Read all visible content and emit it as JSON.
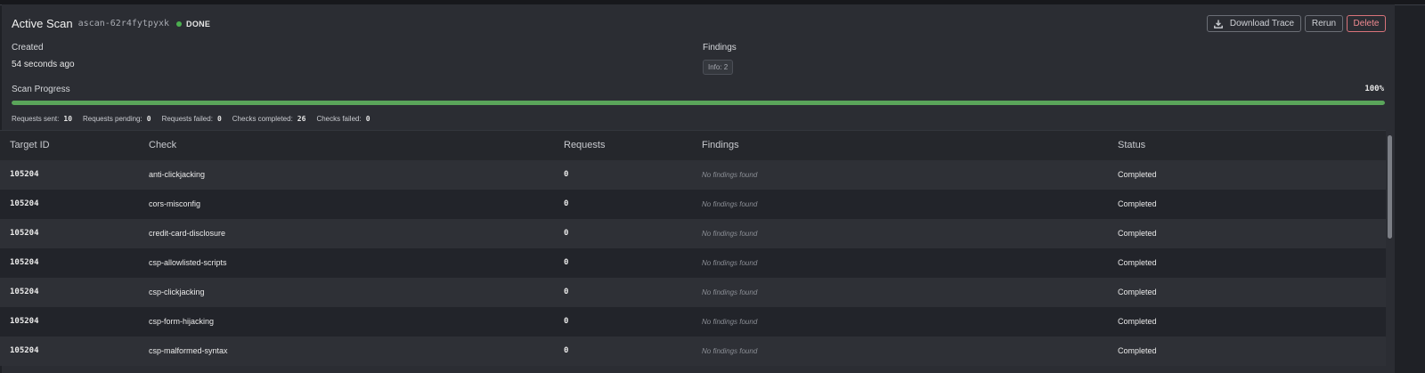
{
  "header": {
    "title": "Active Scan",
    "scan_id": "ascan-62r4fytpyxk",
    "status": "DONE",
    "status_color": "#4caf50"
  },
  "actions": {
    "download": "Download Trace",
    "rerun": "Rerun",
    "delete": "Delete"
  },
  "created": {
    "label": "Created",
    "value": "54 seconds ago"
  },
  "findings": {
    "label": "Findings",
    "badge": "Info: 2"
  },
  "progress": {
    "label": "Scan Progress",
    "percent_text": "100%",
    "percent": 100
  },
  "stats": [
    {
      "label": "Requests sent:",
      "value": "10"
    },
    {
      "label": "Requests pending:",
      "value": "0"
    },
    {
      "label": "Requests failed:",
      "value": "0"
    },
    {
      "label": "Checks completed:",
      "value": "26"
    },
    {
      "label": "Checks failed:",
      "value": "0"
    }
  ],
  "table": {
    "columns": [
      "Target ID",
      "Check",
      "Requests",
      "Findings",
      "Status"
    ],
    "rows": [
      {
        "target": "105204",
        "check": "anti-clickjacking",
        "requests": "0",
        "findings": "No findings found",
        "status": "Completed"
      },
      {
        "target": "105204",
        "check": "cors-misconfig",
        "requests": "0",
        "findings": "No findings found",
        "status": "Completed"
      },
      {
        "target": "105204",
        "check": "credit-card-disclosure",
        "requests": "0",
        "findings": "No findings found",
        "status": "Completed"
      },
      {
        "target": "105204",
        "check": "csp-allowlisted-scripts",
        "requests": "0",
        "findings": "No findings found",
        "status": "Completed"
      },
      {
        "target": "105204",
        "check": "csp-clickjacking",
        "requests": "0",
        "findings": "No findings found",
        "status": "Completed"
      },
      {
        "target": "105204",
        "check": "csp-form-hijacking",
        "requests": "0",
        "findings": "No findings found",
        "status": "Completed"
      },
      {
        "target": "105204",
        "check": "csp-malformed-syntax",
        "requests": "0",
        "findings": "No findings found",
        "status": "Completed"
      }
    ]
  },
  "icons": {
    "download": "download-icon"
  }
}
